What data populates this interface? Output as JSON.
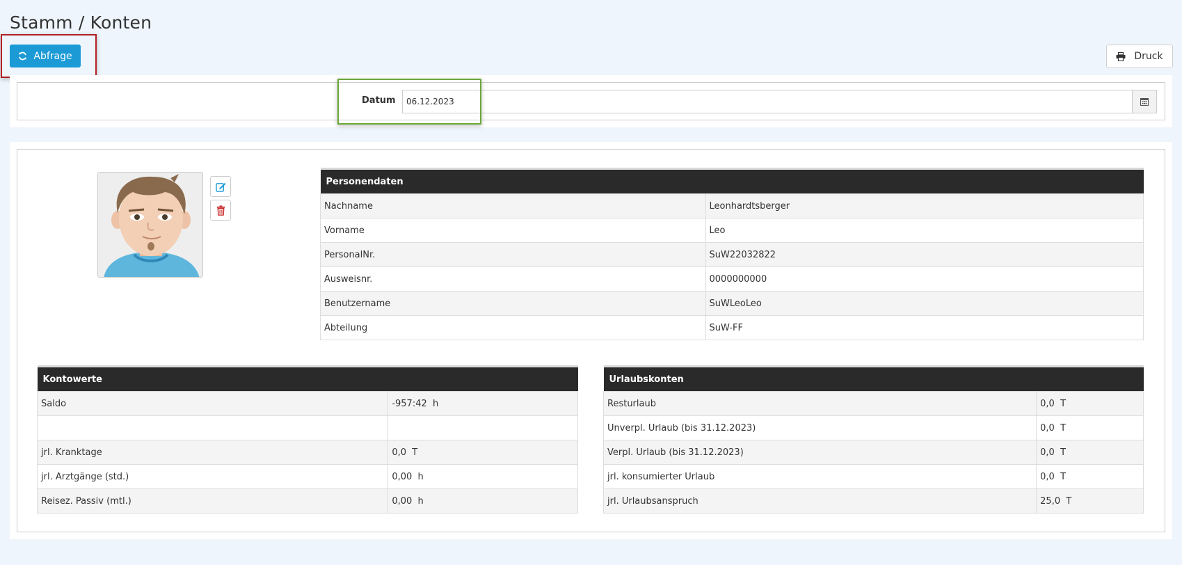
{
  "page": {
    "title": "Stamm / Konten"
  },
  "toolbar": {
    "abfrage_label": "Abfrage",
    "druck_label": "Druck"
  },
  "filter": {
    "datum_label": "Datum",
    "datum_value": "06.12.2023"
  },
  "personendaten": {
    "header": "Personendaten",
    "rows": [
      {
        "label": "Nachname",
        "value": "Leonhardtsberger"
      },
      {
        "label": "Vorname",
        "value": "Leo"
      },
      {
        "label": "PersonalNr.",
        "value": "SuW22032822"
      },
      {
        "label": "Ausweisnr.",
        "value": "0000000000"
      },
      {
        "label": "Benutzername",
        "value": "SuWLeoLeo"
      },
      {
        "label": "Abteilung",
        "value": "SuW-FF"
      }
    ]
  },
  "kontowerte": {
    "header": "Kontowerte",
    "rows": [
      {
        "label": "Saldo",
        "value": "-957:42  h"
      },
      {
        "label": "",
        "value": ""
      },
      {
        "label": "jrl. Kranktage",
        "value": "0,0  T"
      },
      {
        "label": "jrl. Arztgänge (std.)",
        "value": "0,00  h"
      },
      {
        "label": "Reisez. Passiv (mtl.)",
        "value": "0,00  h"
      }
    ]
  },
  "urlaubskonten": {
    "header": "Urlaubskonten",
    "rows": [
      {
        "label": "Resturlaub",
        "value": "0,0  T"
      },
      {
        "label": "Unverpl. Urlaub (bis 31.12.2023)",
        "value": "0,0  T"
      },
      {
        "label": "Verpl. Urlaub (bis 31.12.2023)",
        "value": "0,0  T"
      },
      {
        "label": "jrl. konsumierter Urlaub",
        "value": "0,0  T"
      },
      {
        "label": "jrl. Urlaubsanspruch",
        "value": "25,0  T"
      }
    ]
  },
  "colors": {
    "primary": "#1b9ad6",
    "highlight_red": "#b21f24",
    "highlight_green": "#6aa73a",
    "table_header": "#2a2a2a"
  }
}
